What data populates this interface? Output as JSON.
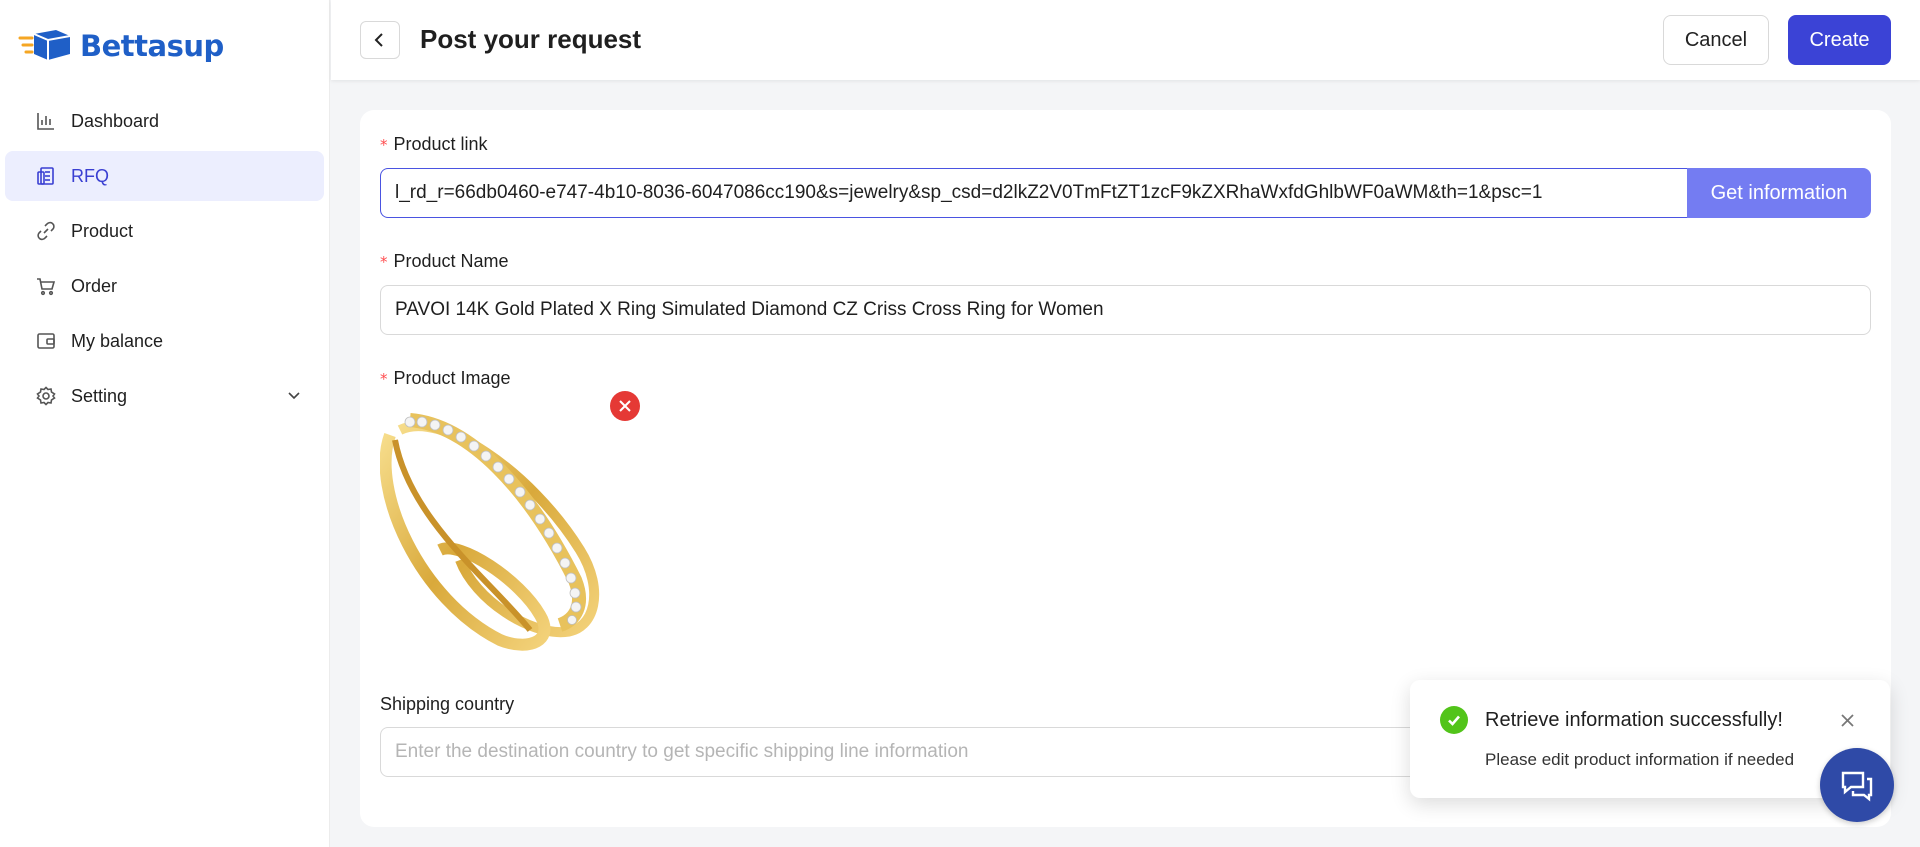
{
  "app": {
    "brand": "Bettasup"
  },
  "sidebar": {
    "items": [
      {
        "label": "Dashboard",
        "icon": "bar-chart-icon"
      },
      {
        "label": "RFQ",
        "icon": "rfq-icon",
        "active": true
      },
      {
        "label": "Product",
        "icon": "link-icon"
      },
      {
        "label": "Order",
        "icon": "cart-icon"
      },
      {
        "label": "My balance",
        "icon": "wallet-icon"
      },
      {
        "label": "Setting",
        "icon": "gear-icon",
        "has_submenu": true
      }
    ]
  },
  "header": {
    "title": "Post your request",
    "cancel_label": "Cancel",
    "create_label": "Create"
  },
  "form": {
    "product_link": {
      "label": "Product link",
      "value": "l_rd_r=66db0460-e747-4b10-8036-6047086cc190&s=jewelry&sp_csd=d2lkZ2V0TmFtZT1zcF9kZXRhaWxfdGhlbWF0aWM&th=1&psc=1",
      "button_label": "Get information"
    },
    "product_name": {
      "label": "Product Name",
      "value": "PAVOI 14K Gold Plated X Ring Simulated Diamond CZ Criss Cross Ring for Women"
    },
    "product_image": {
      "label": "Product Image"
    },
    "shipping_country": {
      "label": "Shipping country",
      "placeholder": "Enter the destination country to get specific shipping line information"
    }
  },
  "toast": {
    "title": "Retrieve information successfully!",
    "message": "Please edit product information if needed"
  },
  "colors": {
    "primary": "#3b43d6",
    "primary_light": "#747cf2",
    "active_bg": "#eceefe",
    "brand_blue": "#1f5fc7",
    "success": "#52c41a",
    "danger": "#e53935",
    "chat": "#2f4aa7"
  }
}
